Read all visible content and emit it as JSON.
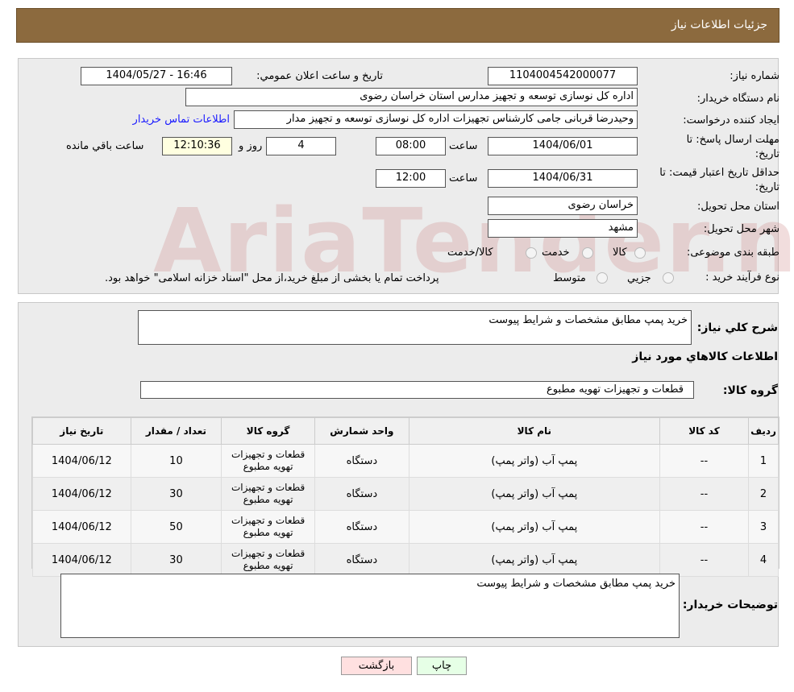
{
  "header": {
    "title": "جزئیات اطلاعات نیاز"
  },
  "form": {
    "need_number_label": "شماره نیاز:",
    "need_number": "1104004542000077",
    "announce_label": "تاریخ و ساعت اعلان عمومي:",
    "announce_value": "1404/05/27 - 16:46",
    "buyer_org_label": "نام دستگاه خريدار:",
    "buyer_org": "اداره کل نوسازی  توسعه و تجهیز مدارس استان خراسان رضوی",
    "creator_label": "ایجاد کننده درخواست:",
    "creator": "وحیدرضا قربانی جامی کارشناس تجهیزات اداره کل نوسازی  توسعه و تجهیز مدار",
    "contact_link": "اطلاعات تماس خریدار",
    "reply_deadline_label": "مهلت ارسال پاسخ: تا تاریخ:",
    "reply_date": "1404/06/01",
    "time_label": "ساعت",
    "reply_time": "08:00",
    "days": "4",
    "days_label": "روز و",
    "remaining": "12:10:36",
    "remaining_label": "ساعت باقي مانده",
    "validity_label": "حداقل تاریخ اعتبار قیمت: تا تاریخ:",
    "validity_date": "1404/06/31",
    "validity_time": "12:00",
    "province_label": "استان محل تحویل:",
    "province": "خراسان رضوی",
    "city_label": "شهر محل تحویل:",
    "city": "مشهد",
    "category_label": "طبقه بندی موضوعی:",
    "category_options": [
      "کالا",
      "خدمت",
      "کالا/خدمت"
    ],
    "process_label": "نوع فرآیند خرید :",
    "process_options": [
      "جزیي",
      "متوسط"
    ],
    "process_note": "پرداخت تمام یا بخشی از مبلغ خرید،از محل \"اسناد خزانه اسلامی\" خواهد بود."
  },
  "watermark": "AriaTender.neT",
  "details": {
    "desc_label": "شرح کلي نياز:",
    "desc": "خرید پمپ مطابق مشخصات و شرایط پیوست",
    "goods_info_title": "اطلاعات کالاهاي مورد نياز",
    "group_label": "گروه کالا:",
    "group": "قطعات و تجهیزات تهویه مطبوع",
    "columns": [
      "ردیف",
      "کد کالا",
      "نام کالا",
      "واحد شمارش",
      "گروه کالا",
      "تعداد / مقدار",
      "تاریخ نیاز"
    ],
    "rows": [
      [
        "1",
        "--",
        "پمپ آب (واتر پمپ)",
        "دستگاه",
        "قطعات و تجهیزات تهویه مطبوع",
        "10",
        "1404/06/12"
      ],
      [
        "2",
        "--",
        "پمپ آب (واتر پمپ)",
        "دستگاه",
        "قطعات و تجهیزات تهویه مطبوع",
        "30",
        "1404/06/12"
      ],
      [
        "3",
        "--",
        "پمپ آب (واتر پمپ)",
        "دستگاه",
        "قطعات و تجهیزات تهویه مطبوع",
        "50",
        "1404/06/12"
      ],
      [
        "4",
        "--",
        "پمپ آب (واتر پمپ)",
        "دستگاه",
        "قطعات و تجهیزات تهویه مطبوع",
        "30",
        "1404/06/12"
      ]
    ],
    "buyer_notes_label": "توضیحات خریدار:",
    "buyer_notes": "خرید پمپ مطابق مشخصات و شرایط پیوست"
  },
  "buttons": {
    "print": "چاپ",
    "back": "بازگشت"
  }
}
